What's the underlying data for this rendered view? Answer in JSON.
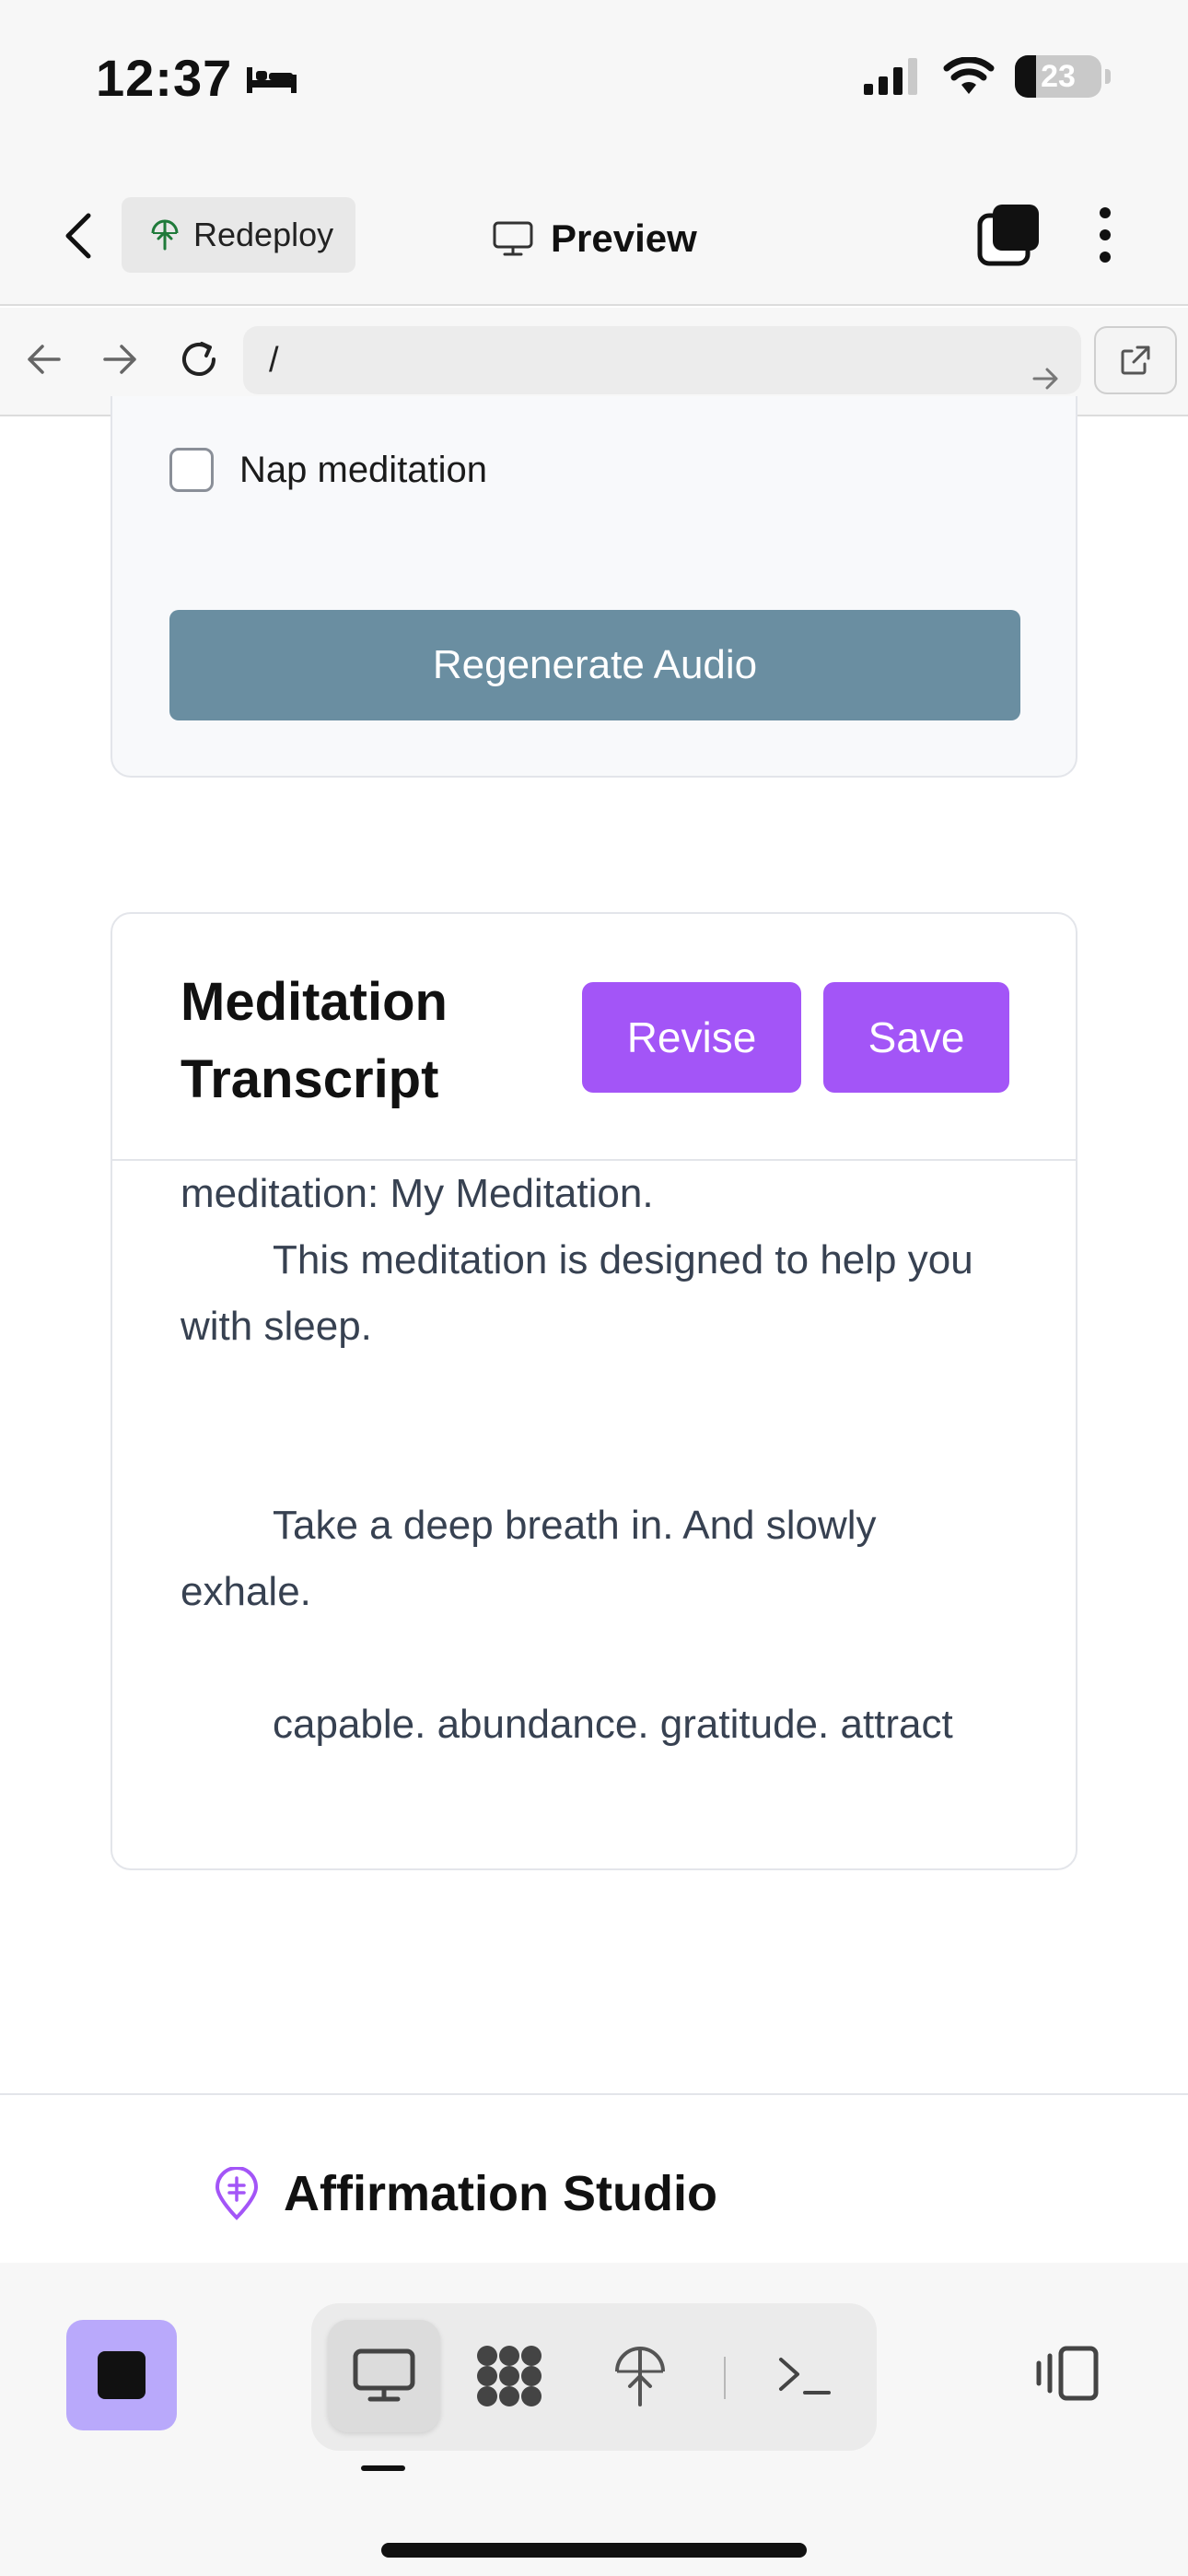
{
  "status_bar": {
    "time": "12:37",
    "battery": "23"
  },
  "top_nav": {
    "redeploy_label": "Redeploy",
    "preview_label": "Preview"
  },
  "url_bar": {
    "url": "/"
  },
  "settings_card": {
    "nap_label": "Nap meditation",
    "regenerate_label": "Regenerate Audio"
  },
  "transcript": {
    "title": "Meditation Transcript",
    "revise_label": "Revise",
    "save_label": "Save",
    "lines": [
      "meditation: My Meditation.",
      "This meditation is designed to help you with sleep.",
      "Take a deep breath in. And slowly exhale.",
      "capable. abundance. gratitude. attract"
    ]
  },
  "footer": {
    "brand": "Affirmation Studio"
  },
  "colors": {
    "purple": "#a355f7",
    "regen_button": "#6a8ea1",
    "stop_button": "#b9a9fb"
  },
  "icons": [
    "back-icon",
    "globe-upload-icon",
    "monitor-icon",
    "tabs-icon",
    "more-icon",
    "arrow-left-icon",
    "arrow-right-icon",
    "reload-icon",
    "go-arrow-icon",
    "open-external-icon",
    "stop-icon",
    "desktop-icon",
    "nodes-icon",
    "deploy-icon",
    "terminal-icon",
    "panel-icon",
    "brand-pin-icon"
  ]
}
